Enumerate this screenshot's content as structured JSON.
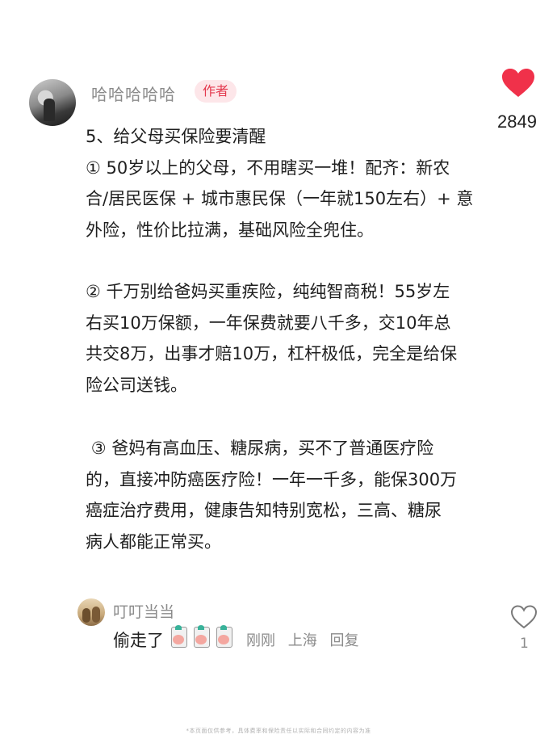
{
  "author": {
    "name": "哈哈哈哈哈",
    "badge": "作者"
  },
  "like": {
    "count": "2849",
    "icon": "heart-filled-icon",
    "color": "#f0314a"
  },
  "post": {
    "title": "5、给父母买保险要清醒",
    "p1": "① 50岁以上的父母，不用瞎买一堆！配齐：新农\n合/居民医保 + 城市惠民保（一年就150左右）+ 意\n外险，性价比拉满，基础风险全兜住。",
    "p2": "② 千万别给爸妈买重疾险，纯纯智商税！55岁左\n右买10万保额，一年保费就要八千多，交10年总\n共交8万，出事才赔10万，杠杆极低，完全是给保\n险公司送钱。",
    "p3": " ③ 爸妈有高血压、糖尿病，买不了普通医疗险\n的，直接冲防癌医疗险！一年一千多，能保300万\n癌症治疗费用，健康告知特别宽松，三高、糖尿\n病人都能正常买。"
  },
  "comment": {
    "name": "叮叮当当",
    "text": "偷走了",
    "time": "刚刚",
    "location": "上海",
    "reply": "回复",
    "like_count": "1",
    "like_icon": "heart-outline-icon"
  },
  "footer": "*本页面仅供参考，具体费率和保险责任以实际和合同约定的内容为准"
}
